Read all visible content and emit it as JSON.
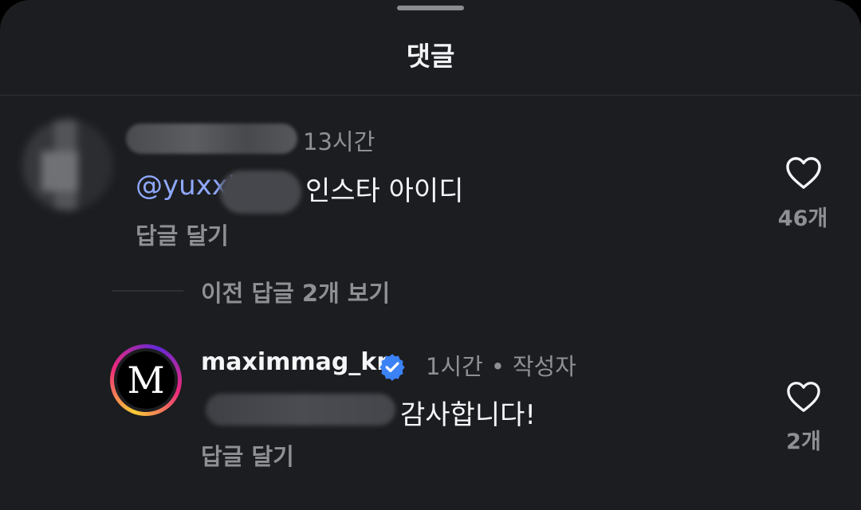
{
  "sheet": {
    "title": "댓글"
  },
  "comments": [
    {
      "time": "13시간",
      "mention": "@yuxx'",
      "text": "인스타 아이디",
      "reply_label": "답글 달기",
      "like_count": "46개"
    },
    {
      "avatar_letter": "M",
      "username": "maximmag_kr",
      "verified": true,
      "time": "1시간",
      "separator": "•",
      "author_tag": "작성자",
      "text": "감사합니다!",
      "reply_label": "답글 달기",
      "like_count": "2개"
    }
  ],
  "view_previous_replies": "이전 답글 2개 보기",
  "colors": {
    "background": "#1c1d20",
    "text": "#f3f5f7",
    "secondary_text": "#8e9094",
    "mention": "#8fa8ff",
    "verified": "#3b82f6"
  },
  "icons": {
    "like": "heart-outline-icon",
    "verified": "verified-badge-icon",
    "mention": "threads-icon"
  }
}
